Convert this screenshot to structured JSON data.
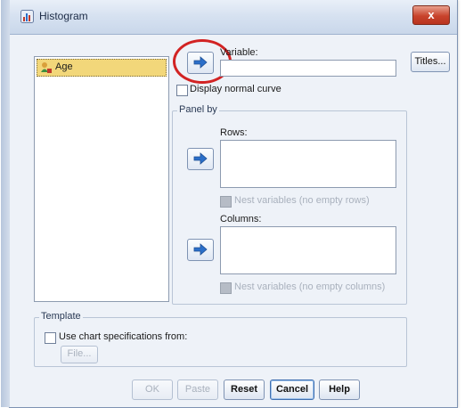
{
  "window": {
    "title": "Histogram",
    "close_label": "x"
  },
  "variables_list": {
    "items": [
      {
        "label": "Age",
        "icon": "scale-variable-icon"
      }
    ]
  },
  "variable": {
    "label": "Variable:",
    "value": ""
  },
  "display_normal_curve": {
    "label": "Display normal curve",
    "checked": false
  },
  "titles_button": "Titles...",
  "panel_by": {
    "title": "Panel by",
    "rows_label": "Rows:",
    "rows_nest_label": "Nest variables (no empty rows)",
    "columns_label": "Columns:",
    "columns_nest_label": "Nest variables (no empty columns)"
  },
  "template": {
    "title": "Template",
    "use_chart_specs_label": "Use chart specifications from:",
    "file_button": "File..."
  },
  "buttons": {
    "ok": "OK",
    "paste": "Paste",
    "reset": "Reset",
    "cancel": "Cancel",
    "help": "Help"
  },
  "colors": {
    "arrow": "#2b6fc9",
    "highlight": "#d22323",
    "selection": "#f2d77a"
  }
}
